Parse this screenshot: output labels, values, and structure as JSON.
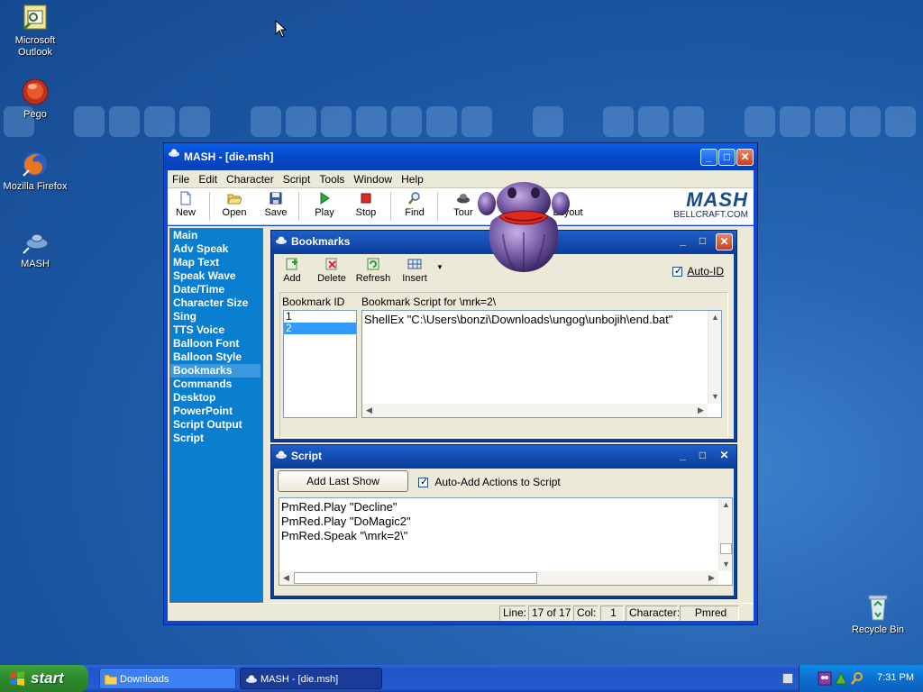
{
  "desktop": {
    "icons": [
      {
        "label_line1": "Microsoft",
        "label_line2": "Outlook",
        "icon": "outlook-icon"
      },
      {
        "label_line1": "Pego",
        "label_line2": "",
        "icon": "pego-icon"
      },
      {
        "label_line1": "Mozilla Firefox",
        "label_line2": "",
        "icon": "firefox-icon"
      },
      {
        "label_line1": "MASH",
        "label_line2": "",
        "icon": "mash-icon"
      },
      {
        "label_line1": "Recycle Bin",
        "label_line2": "",
        "icon": "recycle-bin-icon"
      }
    ]
  },
  "main_window": {
    "title": "MASH - [die.msh]",
    "menu": [
      "File",
      "Edit",
      "Character",
      "Script",
      "Tools",
      "Window",
      "Help"
    ],
    "toolbar": [
      "New",
      "Open",
      "Save",
      "Play",
      "Stop",
      "Find",
      "Tour",
      "Layout"
    ],
    "brand_logo": "MASH",
    "brand_url": "BELLCRAFT.COM"
  },
  "nav": {
    "items": [
      "Main",
      "Adv Speak",
      "Map Text",
      "Speak Wave",
      "Date/Time",
      "Character Size",
      "Sing",
      "TTS Voice",
      "Balloon Font",
      "Balloon Style",
      "Bookmarks",
      "Commands",
      "Desktop",
      "PowerPoint",
      "Script Output",
      "Script"
    ],
    "selected": "Bookmarks"
  },
  "bookmarks": {
    "title": "Bookmarks",
    "toolbar": [
      "Add",
      "Delete",
      "Refresh",
      "Insert"
    ],
    "auto_id_label": "Auto-ID",
    "auto_id_checked": true,
    "id_header": "Bookmark ID",
    "script_header": "Bookmark Script for \\mrk=2\\",
    "ids": [
      "1",
      "2"
    ],
    "selected_id": "2",
    "script_text": "ShellEx \"C:\\Users\\bonzi\\Downloads\\ungog\\unbojih\\end.bat\""
  },
  "script": {
    "title": "Script",
    "add_last_show": "Add Last Show",
    "auto_add_label": "Auto-Add Actions to Script",
    "auto_add_checked": true,
    "lines": [
      "PmRed.Play \"Decline\"",
      "PmRed.Play \"DoMagic2\"",
      "PmRed.Speak \"\\mrk=2\\\""
    ]
  },
  "status": {
    "line_label": "Line:",
    "line_value": "17 of 17",
    "col_label": "Col:",
    "col_value": "1",
    "char_label": "Character:",
    "char_value": "Pmred"
  },
  "taskbar": {
    "start": "start",
    "tasks": [
      "Downloads",
      "MASH - [die.msh]"
    ],
    "clock": "7:31 PM"
  },
  "colors": {
    "xp_blue": "#0a48d8",
    "nav_blue": "#0a7fd0",
    "start_green": "#3fa33f",
    "character_purple": "#7a5fa8",
    "character_lips": "#e0281e"
  }
}
